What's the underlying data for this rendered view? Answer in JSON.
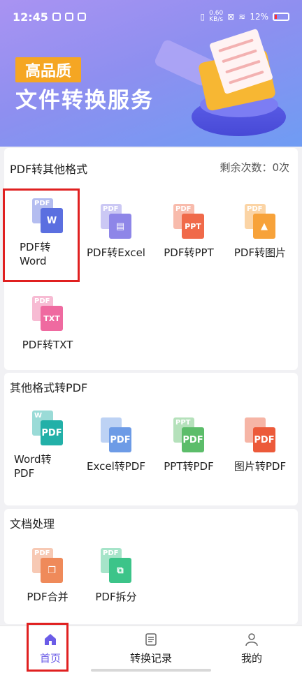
{
  "status_bar": {
    "time": "12:45",
    "net_speed_value": "0.60",
    "net_speed_unit": "KB/s",
    "battery": "12%"
  },
  "banner": {
    "tag": "高品质",
    "headline": "文件转换服务"
  },
  "colors": {
    "word": "#5b6fe0",
    "excel": "#8e86e8",
    "ppt": "#f06a4a",
    "image": "#f7a23a",
    "txt": "#ef6aa0",
    "pdf_teal": "#22b0a8",
    "pdf_blue": "#6d9be6",
    "pdf_green": "#5cbd6a",
    "pdf_red": "#ec5a3a",
    "merge": "#ef8a5a",
    "split": "#3cc489",
    "nav_active": "#6b5ce7"
  },
  "pdf_to_other": {
    "title": "PDF转其他格式",
    "remaining": "剩余次数：0次",
    "tools": [
      {
        "label": "PDF转Word",
        "back": "PDF",
        "front": "W"
      },
      {
        "label": "PDF转Excel",
        "back": "PDF",
        "front": "▤"
      },
      {
        "label": "PDF转PPT",
        "back": "PDF",
        "front": "PPT"
      },
      {
        "label": "PDF转图片",
        "back": "PDF",
        "front": "▲"
      },
      {
        "label": "PDF转TXT",
        "back": "PDF",
        "front": "TXT"
      }
    ]
  },
  "other_to_pdf": {
    "title": "其他格式转PDF",
    "tools": [
      {
        "label": "Word转PDF",
        "back": "W",
        "front": "PDF"
      },
      {
        "label": "Excel转PDF",
        "back": "",
        "front": "PDF"
      },
      {
        "label": "PPT转PDF",
        "back": "PPT",
        "front": "PDF"
      },
      {
        "label": "图片转PDF",
        "back": "",
        "front": "PDF"
      }
    ]
  },
  "doc_process": {
    "title": "文档处理",
    "tools": [
      {
        "label": "PDF合并",
        "back": "PDF",
        "front": "❐"
      },
      {
        "label": "PDF拆分",
        "back": "PDF",
        "front": "⧉"
      }
    ]
  },
  "nav": {
    "home": "首页",
    "history": "转换记录",
    "mine": "我的"
  }
}
